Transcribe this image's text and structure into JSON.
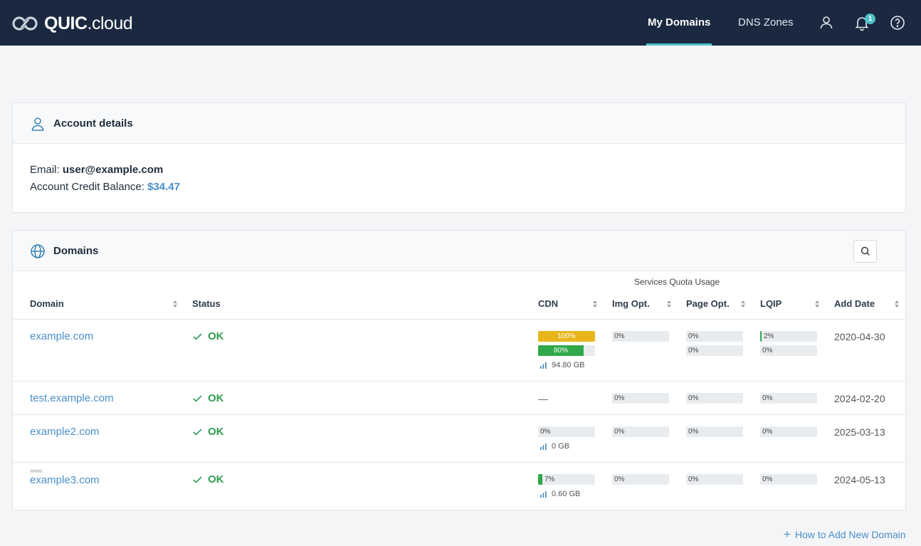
{
  "app": {
    "logo_main": "QUIC",
    "logo_sub": ".cloud"
  },
  "nav": {
    "my_domains": "My Domains",
    "dns_zones": "DNS Zones",
    "notifications_count": "1"
  },
  "account": {
    "title": "Account details",
    "email_label": "Email:",
    "email_value": "user@example.com",
    "credit_label": "Account Credit Balance:",
    "credit_value": "$34.47"
  },
  "domains": {
    "title": "Domains",
    "quota_group_label": "Services Quota Usage",
    "columns": [
      "Domain",
      "Status",
      "CDN",
      "Img Opt.",
      "Page Opt.",
      "LQIP",
      "Add Date"
    ],
    "rows": [
      {
        "domain": "example.com",
        "status": "OK",
        "cdn_bars": [
          "100%",
          "80%"
        ],
        "cdn_usage": "94.80 GB",
        "img_opt": "0%",
        "page_opt": [
          "0%",
          "0%"
        ],
        "lqip": [
          "2%",
          "0%"
        ],
        "add_date": "2020-04-30"
      },
      {
        "domain": "test.example.com",
        "status": "OK",
        "cdn_placeholder": "—",
        "img_opt": "0%",
        "page_opt": [
          "0%"
        ],
        "lqip": [
          "0%"
        ],
        "add_date": "2024-02-20"
      },
      {
        "domain": "example2.com",
        "status": "OK",
        "cdn_bars": [
          "0%"
        ],
        "cdn_usage": "0 GB",
        "img_opt": "0%",
        "page_opt": [
          "0%"
        ],
        "lqip": [
          "0%"
        ],
        "add_date": "2025-03-13"
      },
      {
        "domain_prefix": "www.",
        "domain": "example3.com",
        "status": "OK",
        "cdn_bars": [
          "7%"
        ],
        "cdn_usage": "0.60 GB",
        "img_opt": "0%",
        "page_opt": [
          "0%"
        ],
        "lqip": [
          "0%"
        ],
        "add_date": "2024-05-13"
      }
    ]
  },
  "footer": {
    "add_domain": "How to Add New Domain"
  },
  "colors": {
    "nav_bg": "#1a2940",
    "accent": "#4fc1c9",
    "link": "#4a8ec9",
    "ok": "#2e9e4f",
    "bar_yellow": "#e8b51c",
    "bar_green": "#30a84a"
  }
}
